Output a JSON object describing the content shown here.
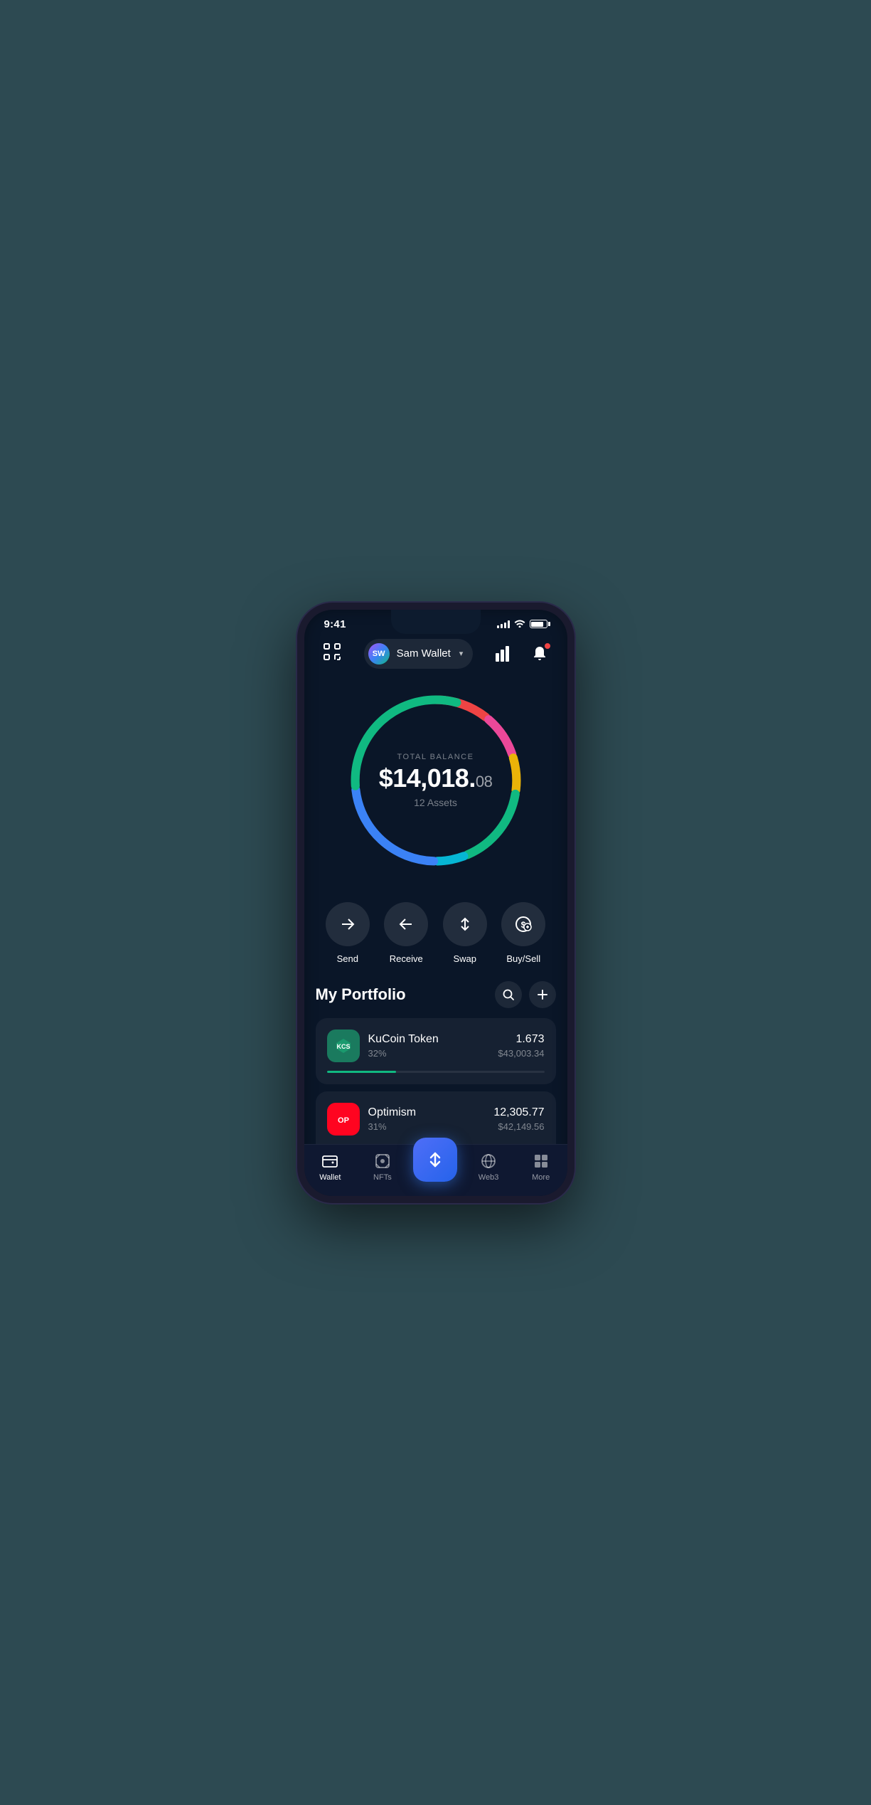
{
  "status": {
    "time": "9:41",
    "signal_bars": [
      3,
      5,
      7,
      9,
      11
    ],
    "battery_level": "85"
  },
  "header": {
    "scan_label": "scan",
    "wallet_initials": "SW",
    "wallet_name": "Sam Wallet",
    "dropdown_symbol": "▾",
    "chart_label": "chart",
    "bell_label": "bell"
  },
  "balance": {
    "label": "TOTAL BALANCE",
    "amount_main": "$14,018.",
    "amount_cents": "08",
    "assets_label": "12 Assets"
  },
  "actions": [
    {
      "id": "send",
      "label": "Send",
      "icon": "→"
    },
    {
      "id": "receive",
      "label": "Receive",
      "icon": "←"
    },
    {
      "id": "swap",
      "label": "Swap",
      "icon": "⇅"
    },
    {
      "id": "buy-sell",
      "label": "Buy/Sell",
      "icon": "$"
    }
  ],
  "portfolio": {
    "title": "My Portfolio",
    "search_label": "search",
    "add_label": "add",
    "assets": [
      {
        "id": "kucoin",
        "name": "KuCoin Token",
        "percentage": "32%",
        "amount": "1.673",
        "usd": "$43,003.34",
        "bar_color": "#10b981",
        "bar_width": "32",
        "icon_text": "KCS"
      },
      {
        "id": "optimism",
        "name": "Optimism",
        "percentage": "31%",
        "amount": "12,305.77",
        "usd": "$42,149.56",
        "bar_color": "#ff6b6b",
        "bar_width": "31",
        "icon_text": "OP"
      }
    ]
  },
  "nav": {
    "items": [
      {
        "id": "wallet",
        "label": "Wallet",
        "active": true
      },
      {
        "id": "nfts",
        "label": "NFTs",
        "active": false
      },
      {
        "id": "swap-center",
        "label": "",
        "active": false
      },
      {
        "id": "web3",
        "label": "Web3",
        "active": false
      },
      {
        "id": "more",
        "label": "More",
        "active": false
      }
    ]
  },
  "donut": {
    "segments": [
      {
        "color": "#ef4444",
        "dash": 60,
        "offset": 0
      },
      {
        "color": "#ec4899",
        "dash": 45,
        "offset": -60
      },
      {
        "color": "#eab308",
        "dash": 35,
        "offset": -105
      },
      {
        "color": "#10b981",
        "dash": 90,
        "offset": -140
      },
      {
        "color": "#06b6d4",
        "dash": 30,
        "offset": -230
      },
      {
        "color": "#3b82f6",
        "dash": 80,
        "offset": -260
      },
      {
        "color": "#6366f1",
        "dash": 40,
        "offset": -340
      }
    ]
  }
}
